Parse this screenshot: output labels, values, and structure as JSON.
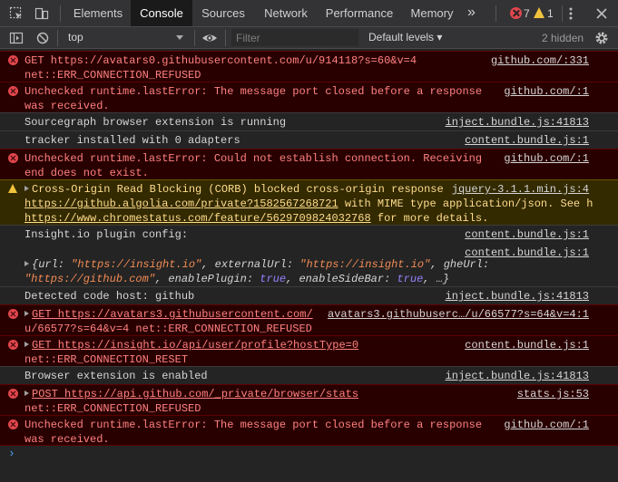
{
  "tabs": [
    {
      "label": "Elements"
    },
    {
      "label": "Console"
    },
    {
      "label": "Sources"
    },
    {
      "label": "Network"
    },
    {
      "label": "Performance"
    },
    {
      "label": "Memory"
    }
  ],
  "more_tabs": "»",
  "error_count": "7",
  "warning_count": "1",
  "toolbar": {
    "context": "top",
    "filter_placeholder": "Filter",
    "levels": "Default levels ▾",
    "hidden": "2 hidden"
  },
  "messages": [
    {
      "level": "error",
      "lines": [
        "GET https://avatars0.githubusercontent.com/u/914118?s=60&v=4",
        "net::ERR_CONNECTION_REFUSED"
      ],
      "source": "github.com/:331"
    },
    {
      "level": "error",
      "lines": [
        "Unchecked runtime.lastError: The message port closed before a response",
        "was received."
      ],
      "source": "github.com/:1"
    },
    {
      "level": "info",
      "lines": [
        "Sourcegraph browser extension is running"
      ],
      "source": "inject.bundle.js:41813"
    },
    {
      "level": "info",
      "lines": [
        "tracker installed with 0 adapters"
      ],
      "source": "content.bundle.js:1"
    },
    {
      "level": "error",
      "lines": [
        "Unchecked runtime.lastError: Could not establish connection. Receiving",
        "end does not exist."
      ],
      "source": "github.com/:1"
    },
    {
      "level": "warning",
      "lines": [
        "Cross-Origin Read Blocking (CORB) blocked cross-origin response",
        "https://github.algolia.com/private?1582567268721",
        "with MIME type application/json. See h",
        "https://www.chromestatus.com/feature/5629709824032768",
        "for more details."
      ],
      "source": "jquery-3.1.1.min.js:4"
    },
    {
      "level": "info",
      "lines": [
        "Insight.io plugin config:"
      ],
      "source": "content.bundle.js:1",
      "source2": "content.bundle.js:1",
      "object": {
        "k1": "url: ",
        "v1": "\"https://insight.io\"",
        "k2": ", externalUrl: ",
        "v2": "\"https://insight.io\"",
        "k3": ", gheUrl:",
        "v3": "\"https://github.com\"",
        "k4": ", enablePlugin: ",
        "v4": "true",
        "k5": ", enableSideBar: ",
        "v5": "true",
        "k6": ", …}"
      }
    },
    {
      "level": "info",
      "lines": [
        "Detected code host: github"
      ],
      "source": "inject.bundle.js:41813"
    },
    {
      "level": "error",
      "lines": [
        "GET https://avatars3.githubusercontent.com/",
        "u/66577?s=64&v=4 net::ERR_CONNECTION_REFUSED"
      ],
      "source": "avatars3.githubuserc…/u/66577?s=64&v=4:1"
    },
    {
      "level": "error",
      "lines": [
        "GET https://insight.io/api/user/profile?hostType=0",
        "net::ERR_CONNECTION_RESET"
      ],
      "source": "content.bundle.js:1"
    },
    {
      "level": "info",
      "lines": [
        "Browser extension is enabled"
      ],
      "source": "inject.bundle.js:41813"
    },
    {
      "level": "error",
      "lines": [
        "POST https://api.github.com/_private/browser/stats",
        "net::ERR_CONNECTION_REFUSED"
      ],
      "source": "stats.js:53"
    },
    {
      "level": "error",
      "lines": [
        "Unchecked runtime.lastError: The message port closed before a response",
        "was received."
      ],
      "source": "github.com/:1"
    }
  ],
  "prompt_symbol": "›"
}
